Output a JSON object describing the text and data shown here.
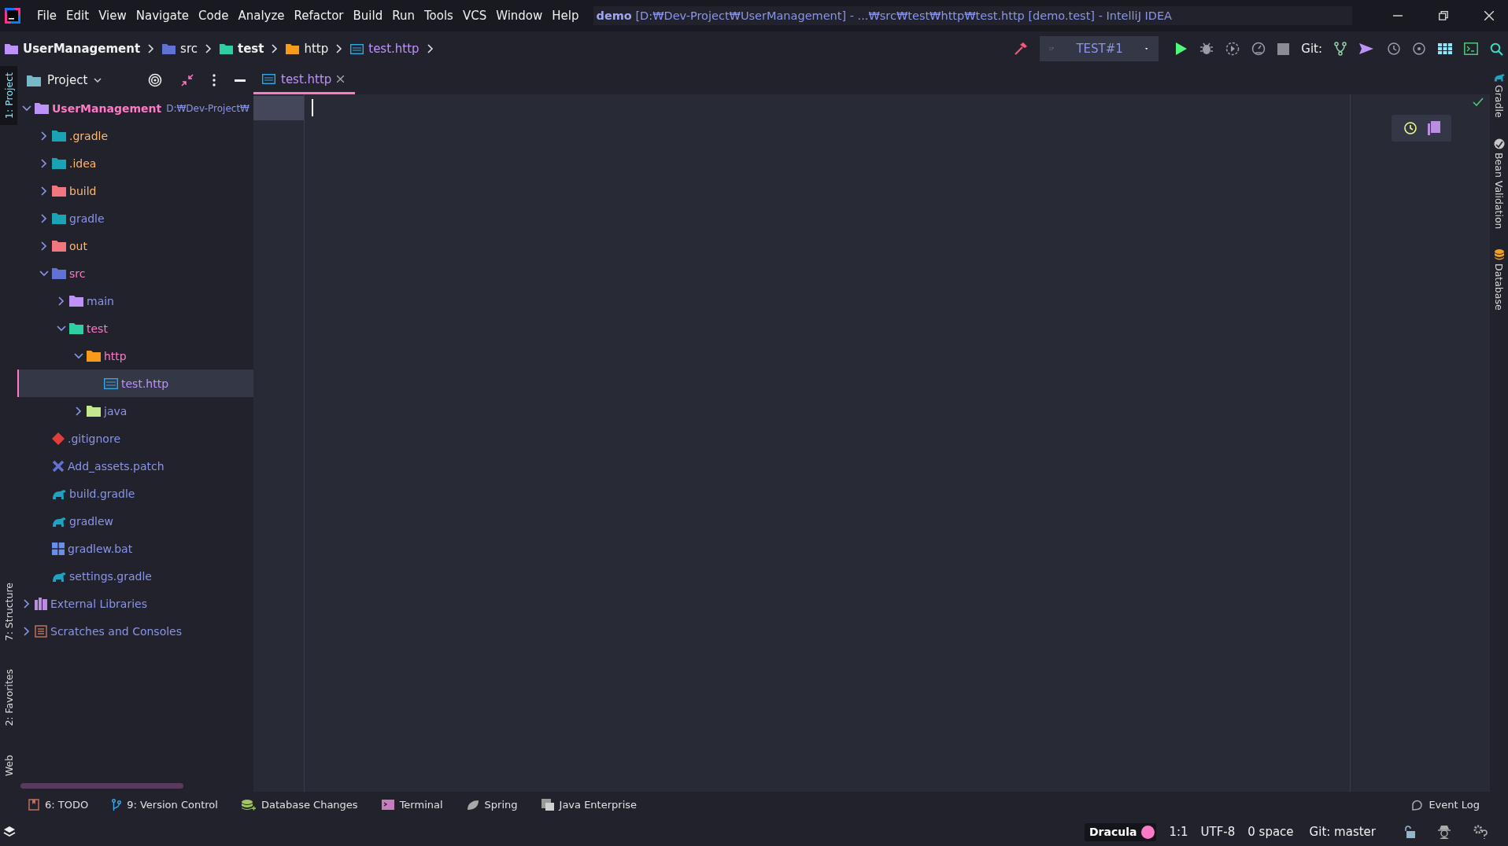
{
  "menu_bar": {
    "items": [
      "File",
      "Edit",
      "View",
      "Navigate",
      "Code",
      "Analyze",
      "Refactor",
      "Build",
      "Run",
      "Tools",
      "VCS",
      "Window",
      "Help"
    ]
  },
  "window_title": {
    "project": "demo",
    "path": "[D:₩Dev-Project₩UserManagement] - ...₩src₩test₩http₩test.http [demo.test] - IntelliJ IDEA"
  },
  "breadcrumbs": [
    {
      "label": "UserManagement",
      "kind": "module",
      "emphasized": true
    },
    {
      "label": "src",
      "kind": "source-folder",
      "emphasized": false
    },
    {
      "label": "test",
      "kind": "test-folder",
      "emphasized": true
    },
    {
      "label": "http",
      "kind": "resource-folder",
      "emphasized": false
    },
    {
      "label": "test.http",
      "kind": "api-file",
      "emphasized": false
    }
  ],
  "run_config": {
    "label": "TEST#1"
  },
  "git_label": "Git:",
  "left_stripe": [
    {
      "label": "1: Project",
      "selected": true
    },
    {
      "label": "7: Structure",
      "selected": false
    },
    {
      "label": "2: Favorites",
      "selected": false
    },
    {
      "label": "Web",
      "selected": false
    }
  ],
  "project_panel": {
    "title": "Project",
    "tree": [
      {
        "label": "UserManagement",
        "path": "D:₩Dev-Project₩",
        "kind": "module",
        "color": "#ff79c6",
        "expanded": true,
        "selected": false,
        "children": [
          {
            "label": ".gradle",
            "kind": "gradle-folder",
            "color": "#ffb86c",
            "expanded": false,
            "selected": false
          },
          {
            "label": ".idea",
            "kind": "idea-folder",
            "color": "#ffb86c",
            "expanded": false,
            "selected": false
          },
          {
            "label": "build",
            "kind": "excluded-folder",
            "color": "#ffb86c",
            "expanded": false,
            "selected": false
          },
          {
            "label": "gradle",
            "kind": "gradle-folder",
            "color": "#8b95e8",
            "expanded": false,
            "selected": false
          },
          {
            "label": "out",
            "kind": "excluded-folder",
            "color": "#ffb86c",
            "expanded": false,
            "selected": false
          },
          {
            "label": "src",
            "kind": "source-folder",
            "color": "#ff79c6",
            "expanded": true,
            "selected": false,
            "children": [
              {
                "label": "main",
                "kind": "main-folder",
                "color": "#8b95e8",
                "expanded": false,
                "selected": false
              },
              {
                "label": "test",
                "kind": "test-folder",
                "color": "#ff79c6",
                "expanded": true,
                "selected": false,
                "children": [
                  {
                    "label": "http",
                    "kind": "resource-folder",
                    "color": "#ff79c6",
                    "expanded": true,
                    "selected": false,
                    "children": [
                      {
                        "label": "test.http",
                        "kind": "api-file",
                        "color": "#bd93f9",
                        "selected": true
                      }
                    ]
                  },
                  {
                    "label": "java",
                    "kind": "java-folder",
                    "color": "#8b95e8",
                    "expanded": false,
                    "selected": false
                  }
                ]
              }
            ]
          },
          {
            "label": ".gitignore",
            "kind": "git-file",
            "color": "#8b95e8",
            "selected": false
          },
          {
            "label": "Add_assets.patch",
            "kind": "patch-file",
            "color": "#8b95e8",
            "selected": false
          },
          {
            "label": "build.gradle",
            "kind": "gradle-file",
            "color": "#8b95e8",
            "selected": false
          },
          {
            "label": "gradlew",
            "kind": "gradle-file",
            "color": "#8b95e8",
            "selected": false
          },
          {
            "label": "gradlew.bat",
            "kind": "windows-file",
            "color": "#8b95e8",
            "selected": false
          },
          {
            "label": "settings.gradle",
            "kind": "gradle-file",
            "color": "#8b95e8",
            "selected": false
          }
        ]
      },
      {
        "label": "External Libraries",
        "kind": "library",
        "color": "#8b95e8",
        "expanded": false,
        "selected": false
      },
      {
        "label": "Scratches and Consoles",
        "kind": "scratches",
        "color": "#8b95e8",
        "expanded": false,
        "selected": false
      }
    ]
  },
  "editor": {
    "tabs": [
      {
        "label": "test.http",
        "kind": "api-file",
        "selected": true
      }
    ]
  },
  "right_stripe": [
    {
      "label": "Gradle",
      "kind": "gradle"
    },
    {
      "label": "Bean Validation",
      "kind": "bean"
    },
    {
      "label": "Database",
      "kind": "database"
    }
  ],
  "tool_windows": [
    {
      "label": "6: TODO",
      "kind": "todo"
    },
    {
      "label": "9: Version Control",
      "kind": "vcs"
    },
    {
      "label": "Database Changes",
      "kind": "db"
    },
    {
      "label": "Terminal",
      "kind": "terminal"
    },
    {
      "label": "Spring",
      "kind": "spring"
    },
    {
      "label": "Java Enterprise",
      "kind": "enterprise"
    }
  ],
  "event_log": "Event Log",
  "status_bar": {
    "theme": "Dracula",
    "position": "1:1",
    "encoding": "UTF-8",
    "indent": "0 space",
    "branch": "Git: master"
  }
}
